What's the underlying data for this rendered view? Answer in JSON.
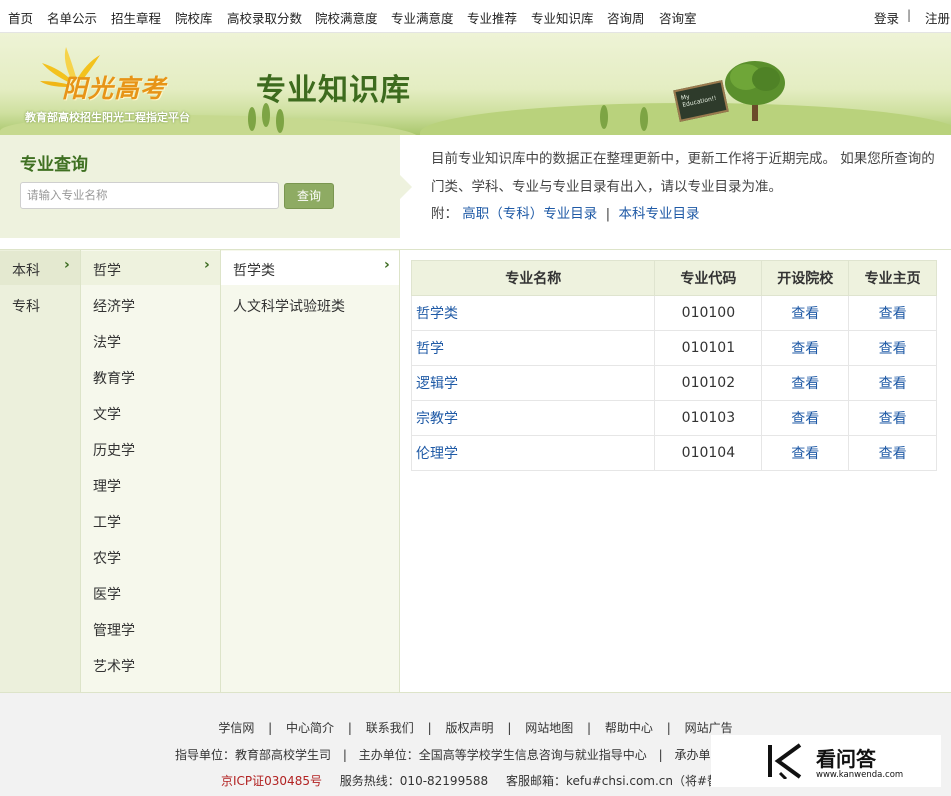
{
  "topnav": {
    "items": [
      "首页",
      "名单公示",
      "招生章程",
      "院校库",
      "高校录取分数",
      "院校满意度",
      "专业满意度",
      "专业推荐",
      "专业知识库",
      "咨询周",
      "咨询室"
    ],
    "login": "登录",
    "separator": "|",
    "register": "注册"
  },
  "banner": {
    "logo_text": "阳光高考",
    "logo_subtitle": "教育部高校招生阳光工程指定平台",
    "title": "专业知识库",
    "board_text": "My Education!!"
  },
  "search": {
    "heading": "专业查询",
    "placeholder": "请输入专业名称",
    "button": "查询"
  },
  "notice": {
    "text": "目前专业知识库中的数据正在整理更新中，更新工作将于近期完成。 如果您所查询的门类、学科、专业与专业目录有出入，请以专业目录为准。",
    "prefix": "附：",
    "link1": "高职（专科）专业目录",
    "sep": "|",
    "link2": "本科专业目录"
  },
  "levels": [
    "本科",
    "专科"
  ],
  "disciplines": [
    "哲学",
    "经济学",
    "法学",
    "教育学",
    "文学",
    "历史学",
    "理学",
    "工学",
    "农学",
    "医学",
    "管理学",
    "艺术学"
  ],
  "subclasses": [
    "哲学类",
    "人文科学试验班类"
  ],
  "chevron": "›",
  "table": {
    "headers": [
      "专业名称",
      "专业代码",
      "开设院校",
      "专业主页"
    ],
    "rows": [
      {
        "name": "哲学类",
        "code": "010100",
        "schools": "查看",
        "home": "查看"
      },
      {
        "name": "哲学",
        "code": "010101",
        "schools": "查看",
        "home": "查看"
      },
      {
        "name": "逻辑学",
        "code": "010102",
        "schools": "查看",
        "home": "查看"
      },
      {
        "name": "宗教学",
        "code": "010103",
        "schools": "查看",
        "home": "查看"
      },
      {
        "name": "伦理学",
        "code": "010104",
        "schools": "查看",
        "home": "查看"
      }
    ]
  },
  "footer": {
    "links": [
      "学信网",
      "中心简介",
      "联系我们",
      "版权声明",
      "网站地图",
      "帮助中心",
      "网站广告"
    ],
    "sep": "|",
    "guide": "指导单位：教育部高校学生司",
    "host": "主办单位：全国高等学校学生信息咨询与就业指导中心",
    "organizer": "承办单",
    "icp": "京ICP证030485号",
    "hotline": "服务热线：010-82199588",
    "email": "客服邮箱：kefu#chsi.com.cn（将#替换为@"
  },
  "watermark": {
    "title": "看问答",
    "url": "www.kanwenda.com"
  },
  "colors": {
    "accent_green": "#3f7022",
    "link_blue": "#1f5aa6",
    "panel_bg": "#eef2de",
    "button_green": "#8eab63",
    "icp_red": "#b22222"
  }
}
